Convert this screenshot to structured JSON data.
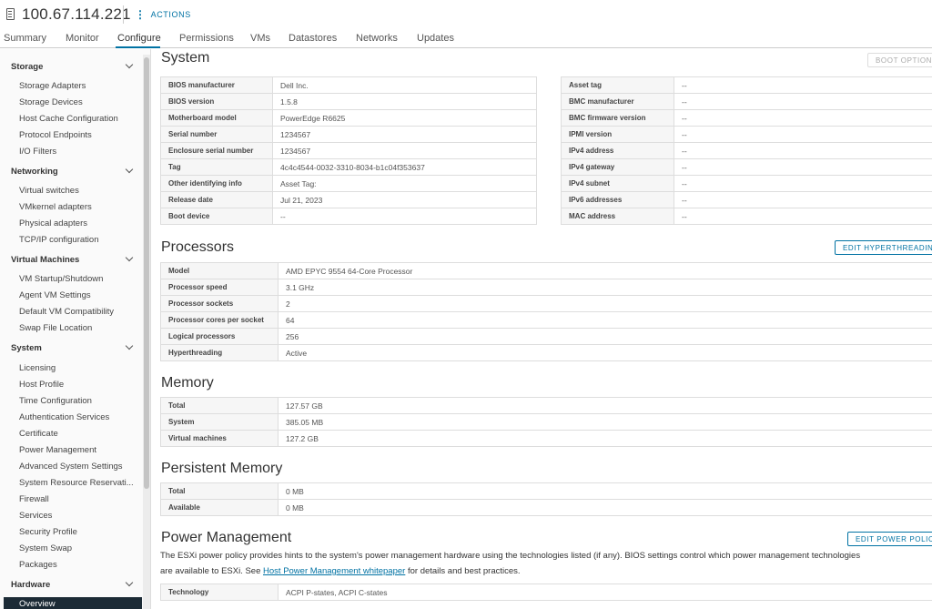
{
  "header": {
    "host": "100.67.114.221",
    "actions_label": "ACTIONS"
  },
  "tabs": [
    "Summary",
    "Monitor",
    "Configure",
    "Permissions",
    "VMs",
    "Datastores",
    "Networks",
    "Updates"
  ],
  "sidebar": {
    "groups": [
      {
        "label": "Storage",
        "items": [
          "Storage Adapters",
          "Storage Devices",
          "Host Cache Configuration",
          "Protocol Endpoints",
          "I/O Filters"
        ]
      },
      {
        "label": "Networking",
        "items": [
          "Virtual switches",
          "VMkernel adapters",
          "Physical adapters",
          "TCP/IP configuration"
        ]
      },
      {
        "label": "Virtual Machines",
        "items": [
          "VM Startup/Shutdown",
          "Agent VM Settings",
          "Default VM Compatibility",
          "Swap File Location"
        ]
      },
      {
        "label": "System",
        "items": [
          "Licensing",
          "Host Profile",
          "Time Configuration",
          "Authentication Services",
          "Certificate",
          "Power Management",
          "Advanced System Settings",
          "System Resource Reservati...",
          "Firewall",
          "Services",
          "Security Profile",
          "System Swap",
          "Packages"
        ]
      },
      {
        "label": "Hardware",
        "items": []
      }
    ],
    "selected": "Overview"
  },
  "system": {
    "title": "System",
    "boot_options_label": "BOOT OPTIONS",
    "left": [
      {
        "k": "BIOS manufacturer",
        "v": "Dell Inc."
      },
      {
        "k": "BIOS version",
        "v": "1.5.8"
      },
      {
        "k": "Motherboard model",
        "v": "PowerEdge R6625"
      },
      {
        "k": "Serial number",
        "v": "1234567"
      },
      {
        "k": "Enclosure serial number",
        "v": "1234567"
      },
      {
        "k": "Tag",
        "v": "4c4c4544-0032-3310-8034-b1c04f353637"
      },
      {
        "k": "Other identifying info",
        "v": "Asset Tag:"
      },
      {
        "k": "Release date",
        "v": "Jul 21, 2023"
      },
      {
        "k": "Boot device",
        "v": "--"
      }
    ],
    "right": [
      {
        "k": "Asset tag",
        "v": "--"
      },
      {
        "k": "BMC manufacturer",
        "v": "--"
      },
      {
        "k": "BMC firmware version",
        "v": "--"
      },
      {
        "k": "IPMI version",
        "v": "--"
      },
      {
        "k": "IPv4 address",
        "v": "--"
      },
      {
        "k": "IPv4 gateway",
        "v": "--"
      },
      {
        "k": "IPv4 subnet",
        "v": "--"
      },
      {
        "k": "IPv6 addresses",
        "v": "--"
      },
      {
        "k": "MAC address",
        "v": "--"
      }
    ]
  },
  "processors": {
    "title": "Processors",
    "button_label": "EDIT HYPERTHREADING",
    "rows": [
      {
        "k": "Model",
        "v": "AMD EPYC 9554 64-Core Processor"
      },
      {
        "k": "Processor speed",
        "v": "3.1 GHz"
      },
      {
        "k": "Processor sockets",
        "v": "2"
      },
      {
        "k": "Processor cores per socket",
        "v": "64"
      },
      {
        "k": "Logical processors",
        "v": "256"
      },
      {
        "k": "Hyperthreading",
        "v": "Active"
      }
    ]
  },
  "memory": {
    "title": "Memory",
    "rows": [
      {
        "k": "Total",
        "v": "127.57 GB"
      },
      {
        "k": "System",
        "v": "385.05 MB"
      },
      {
        "k": "Virtual machines",
        "v": "127.2 GB"
      }
    ]
  },
  "persistent_memory": {
    "title": "Persistent Memory",
    "rows": [
      {
        "k": "Total",
        "v": "0 MB"
      },
      {
        "k": "Available",
        "v": "0 MB"
      }
    ]
  },
  "power": {
    "title": "Power Management",
    "button_label": "EDIT POWER POLICY",
    "line1": "The ESXi power policy provides hints to the system's power management hardware using the technologies listed (if any). BIOS settings control which power management technologies",
    "line2_prefix": "are available to ESXi. See ",
    "line2_link": "Host Power Management whitepaper",
    "line2_suffix": " for details and best practices.",
    "rows": [
      {
        "k": "Technology",
        "v": "ACPI P-states, ACPI C-states"
      }
    ]
  }
}
